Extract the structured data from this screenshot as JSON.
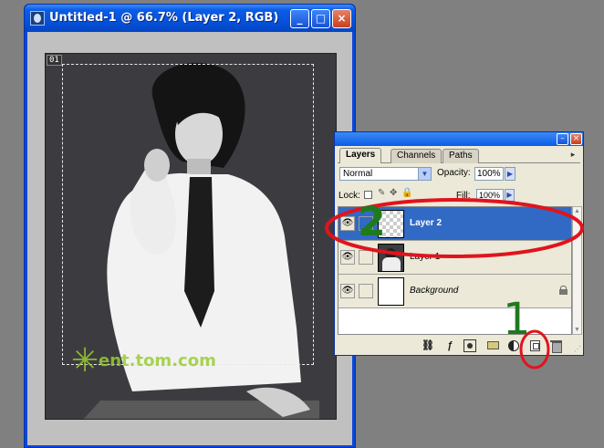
{
  "document_window": {
    "title": "Untitled-1 @ 66.7% (Layer 2, RGB)",
    "buttons": {
      "minimize": "_",
      "maximize": "□",
      "close": "×"
    },
    "canvas_tag": "01",
    "watermark": "ent.tom.com"
  },
  "layers_panel": {
    "tabs": [
      {
        "label": "Layers",
        "active": true
      },
      {
        "label": "Channels",
        "active": false
      },
      {
        "label": "Paths",
        "active": false
      }
    ],
    "blend_mode": "Normal",
    "opacity_label": "Opacity:",
    "opacity_value": "100%",
    "lock_label": "Lock:",
    "fill_label": "Fill:",
    "fill_value": "100%",
    "layers": [
      {
        "name": "Layer 2",
        "selected": true,
        "visible": true,
        "thumb": "transparent"
      },
      {
        "name": "Layer 1",
        "selected": false,
        "visible": true,
        "thumb": "photo"
      },
      {
        "name": "Background",
        "selected": false,
        "visible": true,
        "thumb": "white",
        "locked": true
      }
    ],
    "bottom_buttons": [
      "link-layers",
      "layer-style",
      "add-mask",
      "new-group",
      "adjustment-layer",
      "new-layer",
      "delete-layer"
    ]
  },
  "annotations": {
    "marker_1": "1",
    "marker_2": "2",
    "color": "#e0141e",
    "marker_color": "#1f7a1f"
  },
  "colors": {
    "titlebar": "#0a5ce6",
    "selection": "#316ac5",
    "panel_bg": "#ece9d8",
    "workspace": "#808080"
  }
}
